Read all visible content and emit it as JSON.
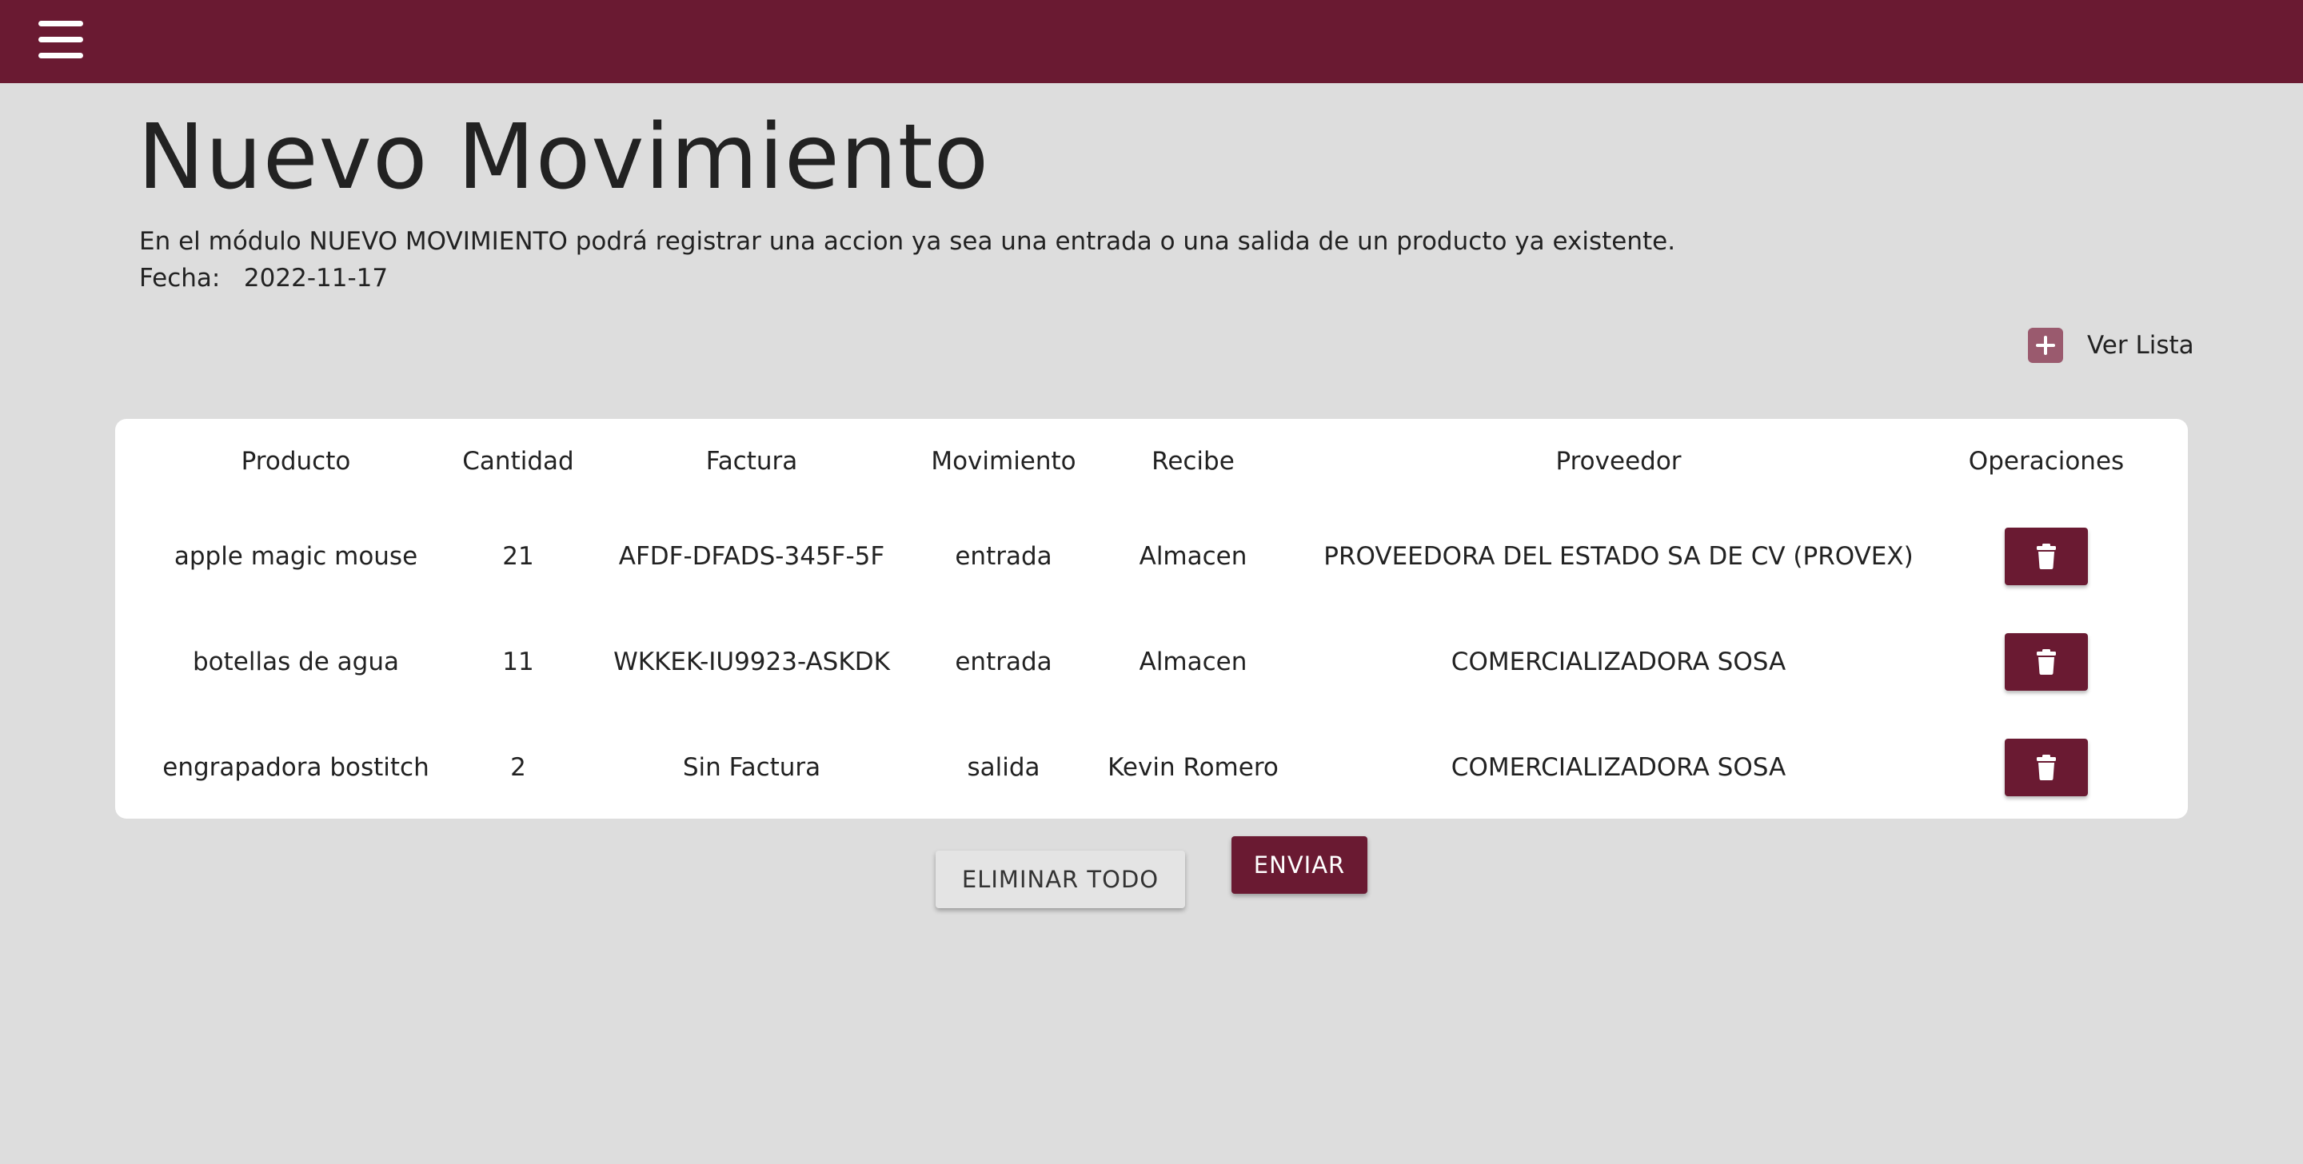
{
  "colors": {
    "brand": "#6a1a32",
    "background": "#dddddd",
    "card": "#ffffff",
    "plus_icon": "#9a5a6e"
  },
  "header": {
    "menu_icon": "hamburger-menu-icon"
  },
  "page": {
    "title": "Nuevo Movimiento",
    "description": "En el módulo NUEVO MOVIMIENTO podrá registrar una accion ya sea una entrada o una salida de un producto ya existente.",
    "date_label": "Fecha:",
    "date_value": "2022-11-17"
  },
  "actions": {
    "ver_lista_icon": "plus-square-icon",
    "ver_lista_label": "Ver Lista",
    "eliminar_todo_label": "ELIMINAR TODO",
    "enviar_label": "ENVIAR"
  },
  "table": {
    "headers": [
      "Producto",
      "Cantidad",
      "Factura",
      "Movimiento",
      "Recibe",
      "Proveedor",
      "Operaciones"
    ],
    "delete_icon": "trash-icon",
    "rows": [
      {
        "producto": "apple magic mouse",
        "cantidad": "21",
        "factura": "AFDF-DFADS-345F-5F",
        "movimiento": "entrada",
        "recibe": "Almacen",
        "proveedor": "PROVEEDORA DEL ESTADO SA DE CV (PROVEX)"
      },
      {
        "producto": "botellas de agua",
        "cantidad": "11",
        "factura": "WKKEK-IU9923-ASKDK",
        "movimiento": "entrada",
        "recibe": "Almacen",
        "proveedor": "COMERCIALIZADORA SOSA"
      },
      {
        "producto": "engrapadora bostitch",
        "cantidad": "2",
        "factura": "Sin Factura",
        "movimiento": "salida",
        "recibe": "Kevin Romero",
        "proveedor": "COMERCIALIZADORA SOSA"
      }
    ]
  }
}
